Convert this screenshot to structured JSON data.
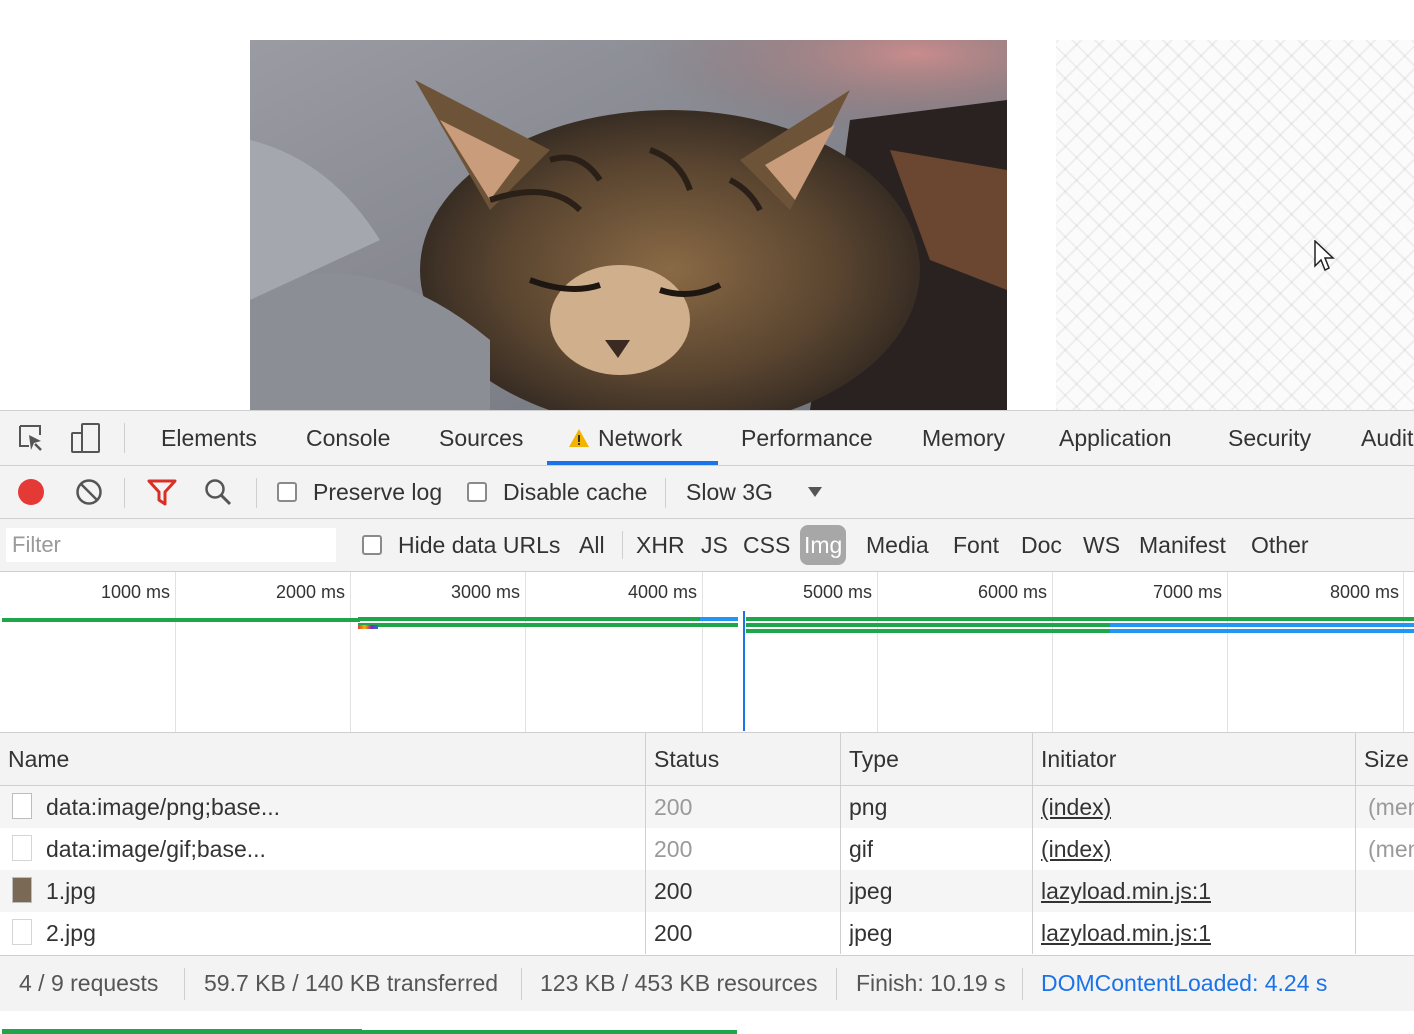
{
  "tabs": {
    "elements": "Elements",
    "console": "Console",
    "sources": "Sources",
    "network": "Network",
    "performance": "Performance",
    "memory": "Memory",
    "application": "Application",
    "security": "Security",
    "audits": "Audits"
  },
  "toolbar": {
    "preserve_log": "Preserve log",
    "disable_cache": "Disable cache",
    "throttle": "Slow 3G"
  },
  "filter": {
    "placeholder": "Filter",
    "hide_data_urls": "Hide data URLs",
    "types": [
      "All",
      "XHR",
      "JS",
      "CSS",
      "Img",
      "Media",
      "Font",
      "Doc",
      "WS",
      "Manifest",
      "Other"
    ],
    "selected": "Img"
  },
  "timeline": {
    "ticks": [
      "1000 ms",
      "2000 ms",
      "3000 ms",
      "4000 ms",
      "5000 ms",
      "6000 ms",
      "7000 ms",
      "8000 ms"
    ]
  },
  "table": {
    "headers": {
      "name": "Name",
      "status": "Status",
      "type": "Type",
      "initiator": "Initiator",
      "size": "Size"
    },
    "rows": [
      {
        "name": "data:image/png;base...",
        "status": "200",
        "type": "png",
        "initiator": "(index)",
        "size": "(mem"
      },
      {
        "name": "data:image/gif;base...",
        "status": "200",
        "type": "gif",
        "initiator": "(index)",
        "size": "(mem"
      },
      {
        "name": "1.jpg",
        "status": "200",
        "type": "jpeg",
        "initiator": "lazyload.min.js:1",
        "size": ""
      },
      {
        "name": "2.jpg",
        "status": "200",
        "type": "jpeg",
        "initiator": "lazyload.min.js:1",
        "size": ""
      }
    ]
  },
  "status": {
    "requests": "4 / 9 requests",
    "transferred": "59.7 KB / 140 KB transferred",
    "resources": "123 KB / 453 KB resources",
    "finish": "Finish: 10.19 s",
    "dcl": "DOMContentLoaded: 4.24 s"
  },
  "colors": {
    "accent": "#1a73e8",
    "record": "#e53935",
    "filter_active": "#d93025",
    "bar_green": "#1fa64a",
    "bar_blue": "#2196f3",
    "warning": "#f2b400"
  }
}
